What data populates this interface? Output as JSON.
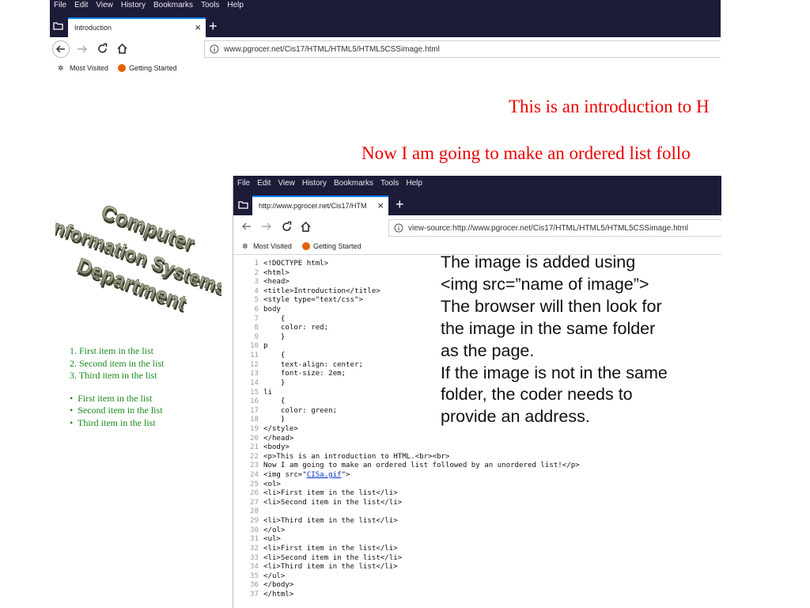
{
  "outer_browser": {
    "menu": [
      "File",
      "Edit",
      "View",
      "History",
      "Bookmarks",
      "Tools",
      "Help"
    ],
    "tab_title": "Introduction",
    "tab_close": "×",
    "new_tab": "+",
    "url": "www.pgrocer.net/Cis17/HTML/HTML5/HTML5CSSimage.html",
    "bookmarks": [
      "Most Visited",
      "Getting Started"
    ],
    "page": {
      "p1": "This is an introduction to H",
      "p2": "Now I am going to make an ordered list follo",
      "logo_lines": [
        "Computer",
        "Information Systems",
        "Department"
      ],
      "ordered_list": [
        "First item in the list",
        "Second item in the list",
        "Third item in the list"
      ],
      "ordered_markers": [
        "1.",
        "2.",
        "3."
      ],
      "unordered_list": [
        "First item in the list",
        "Second item in the list",
        "Third item in the list"
      ],
      "bullet": "•"
    }
  },
  "inner_browser": {
    "menu": [
      "File",
      "Edit",
      "View",
      "History",
      "Bookmarks",
      "Tools",
      "Help"
    ],
    "tab_title": "http://www.pgrocer.net/Cis17/HTM",
    "tab_close": "×",
    "new_tab": "+",
    "url": "view-source:http://www.pgrocer.net/Cis17/HTML/HTML5/HTML5CSSimage.html",
    "bookmarks": [
      "Most Visited",
      "Getting Started"
    ],
    "source_lines": [
      {
        "n": "1",
        "code": "<!DOCTYPE html>"
      },
      {
        "n": "2",
        "code": "<html>"
      },
      {
        "n": "3",
        "code": "<head>"
      },
      {
        "n": "4",
        "code": "<title>Introduction</title>"
      },
      {
        "n": "5",
        "code": "<style type=\"text/css\">"
      },
      {
        "n": "6",
        "code": "body"
      },
      {
        "n": "7",
        "code": "    {"
      },
      {
        "n": "8",
        "code": "    color: red;"
      },
      {
        "n": "9",
        "code": "    }"
      },
      {
        "n": "10",
        "code": "p"
      },
      {
        "n": "11",
        "code": "    {"
      },
      {
        "n": "12",
        "code": "    text-align: center;"
      },
      {
        "n": "13",
        "code": "    font-size: 2em;"
      },
      {
        "n": "14",
        "code": "    }"
      },
      {
        "n": "15",
        "code": "li"
      },
      {
        "n": "16",
        "code": "    {"
      },
      {
        "n": "17",
        "code": "    color: green;"
      },
      {
        "n": "18",
        "code": "    }"
      },
      {
        "n": "19",
        "code": "</style>"
      },
      {
        "n": "20",
        "code": "</head>"
      },
      {
        "n": "21",
        "code": "<body>"
      },
      {
        "n": "22",
        "code": "<p>This is an introduction to HTML.<br><br>"
      },
      {
        "n": "23",
        "code": "Now I am going to make an ordered list followed by an unordered list!</p>"
      },
      {
        "n": "24",
        "code_pre": "<img src=\"",
        "code_link": "CISa.gif",
        "code_post": "\">"
      },
      {
        "n": "25",
        "code": "<ol>"
      },
      {
        "n": "26",
        "code": "<li>First item in the list</li>"
      },
      {
        "n": "27",
        "code": "<li>Second item in the list</li>"
      },
      {
        "n": "28",
        "code": ""
      },
      {
        "n": "29",
        "code": "<li>Third item in the list</li>"
      },
      {
        "n": "30",
        "code": "</ol>"
      },
      {
        "n": "31",
        "code": "<ul>"
      },
      {
        "n": "32",
        "code": "<li>First item in the list</li>"
      },
      {
        "n": "33",
        "code": "<li>Second item in the list</li>"
      },
      {
        "n": "34",
        "code": "<li>Third item in the list</li>"
      },
      {
        "n": "35",
        "code": "</ul>"
      },
      {
        "n": "36",
        "code": "</body>"
      },
      {
        "n": "37",
        "code": "</html>"
      }
    ]
  },
  "annotation": "The image is added using\n<img src=”name of image”>\nThe browser will then look for\nthe image in the same folder\nas the page.\nIf the image is not in the same\nfolder, the coder needs to\nprovide an address.",
  "colors": {
    "chrome_dark": "#1c1b38",
    "page_red": "#e00000",
    "list_green": "#1a8a1a",
    "tab_accent": "#0a84ff",
    "link_blue": "#0033cc"
  }
}
